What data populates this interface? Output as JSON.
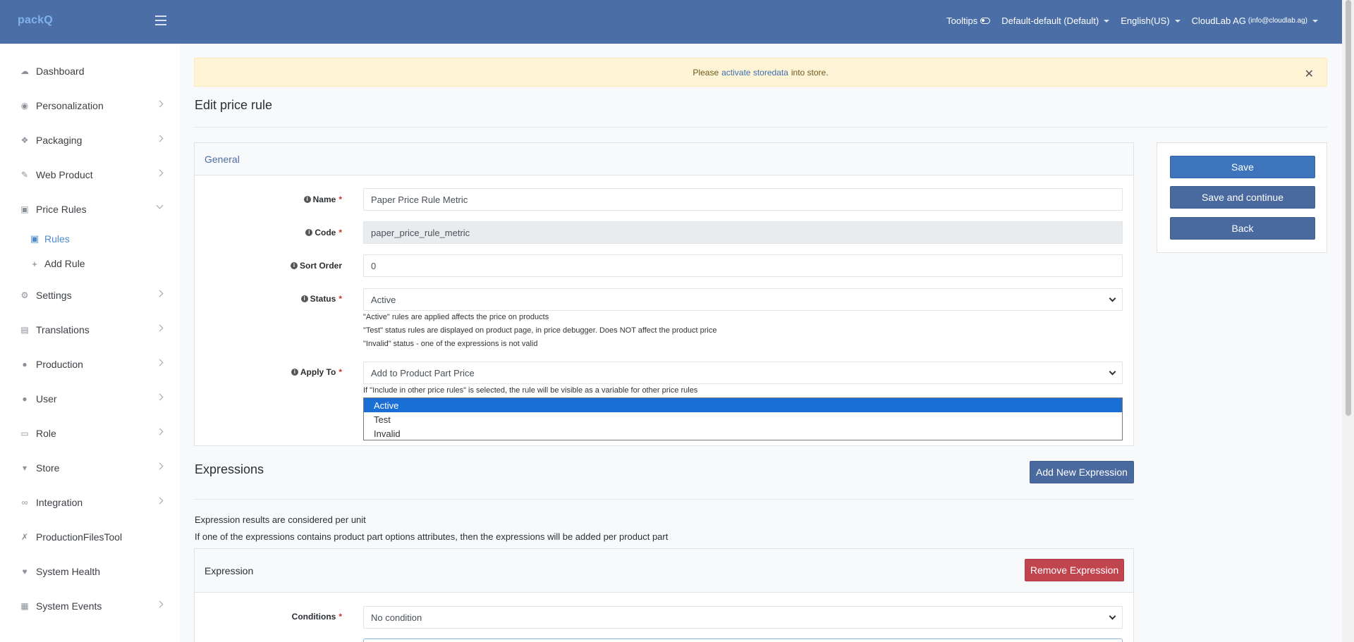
{
  "header": {
    "logo": "packQ",
    "tooltips_label": "Tooltips",
    "store_selector": "Default-default (Default)",
    "language": "English(US)",
    "account_name": "CloudLab AG",
    "account_email": "(info@cloudlab.ag)"
  },
  "sidebar": {
    "items": [
      {
        "label": "Dashboard",
        "icon": "cloud-icon"
      },
      {
        "label": "Personalization",
        "icon": "eye-icon"
      },
      {
        "label": "Packaging",
        "icon": "dropbox-icon"
      },
      {
        "label": "Web Product",
        "icon": "pen-icon"
      },
      {
        "label": "Price Rules",
        "icon": "money-icon"
      },
      {
        "label": "Settings",
        "icon": "gears-icon"
      },
      {
        "label": "Translations",
        "icon": "language-icon"
      },
      {
        "label": "Production",
        "icon": "production-icon"
      },
      {
        "label": "User",
        "icon": "user-icon"
      },
      {
        "label": "Role",
        "icon": "id-card-icon"
      },
      {
        "label": "Store",
        "icon": "cart-icon"
      },
      {
        "label": "Integration",
        "icon": "link-icon"
      },
      {
        "label": "ProductionFilesTool",
        "icon": "wrench-icon"
      },
      {
        "label": "System Health",
        "icon": "heartbeat-icon"
      },
      {
        "label": "System Events",
        "icon": "calendar-icon"
      }
    ],
    "sub_items": [
      {
        "label": "Rules"
      },
      {
        "label": "Add Rule"
      }
    ]
  },
  "alert": {
    "prefix": "Please",
    "link": "activate storedata",
    "suffix": "into store."
  },
  "page": {
    "title": "Edit price rule"
  },
  "general": {
    "title": "General",
    "name_label": "Name",
    "name_value": "Paper Price Rule Metric",
    "code_label": "Code",
    "code_value": "paper_price_rule_metric",
    "sort_label": "Sort Order",
    "sort_value": "0",
    "status_label": "Status",
    "status_value": "Active",
    "status_help": [
      "\"Active\" rules are applied affects the price on products",
      "\"Test\" status rules are displayed on product page, in price debugger. Does NOT affect the product price",
      "\"Invalid\" status - one of the expressions is not valid"
    ],
    "apply_label": "Apply To",
    "apply_value": "Add to Product Part Price",
    "apply_help": "If \"Include in other price rules\" is selected, the rule will be visible as a variable for other price rules",
    "status_options": [
      "Active",
      "Test",
      "Invalid"
    ]
  },
  "actions": {
    "save": "Save",
    "save_continue": "Save and continue",
    "back": "Back"
  },
  "expressions": {
    "title": "Expressions",
    "add_button": "Add New Expression",
    "note1": "Expression results are considered per unit",
    "note2": "If one of the expressions contains product part options attributes, then the expressions will be added per product part",
    "card_title": "Expression",
    "remove_button": "Remove Expression",
    "conditions_label": "Conditions",
    "conditions_value": "No condition"
  }
}
